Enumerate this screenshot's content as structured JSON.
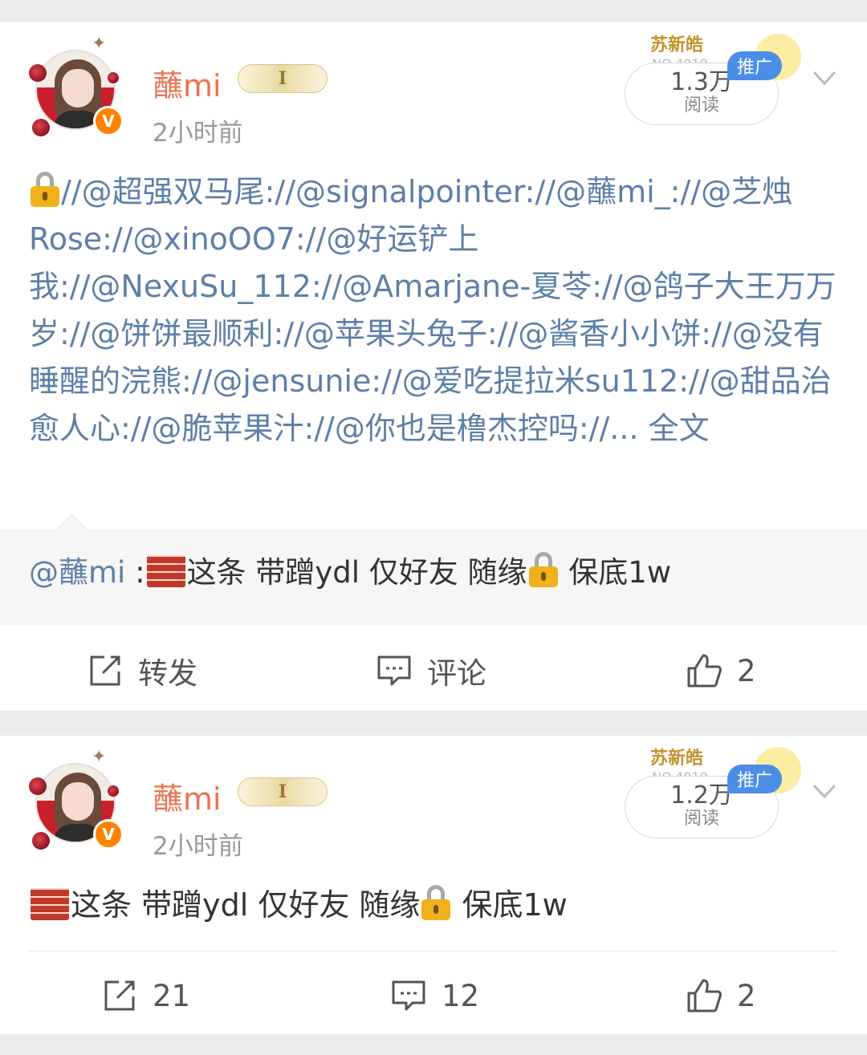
{
  "posts": [
    {
      "username": "蘸mi",
      "member_badge": "I",
      "timestamp": "2小时前",
      "ad_name": "苏新皓",
      "ad_no": "NO.4010",
      "promo_label": "推广",
      "reads_count": "1.3万",
      "reads_label": "阅读",
      "content_segments": [
        "//@超强双马尾",
        "://@signalpointer",
        "://@蘸mi_",
        "://@芝烛Rose",
        "://@xinoOO7",
        "://@好运铲上我",
        "://@NexuSu_112",
        "://@Amarjane-夏苓",
        "://@鸽子大王万万岁",
        "://@饼饼最顺利",
        "://@苹果头兔子",
        "://@酱香小小饼",
        "://@没有睡醒的浣熊",
        "://@jensunie",
        "://@爱吃提拉米su112",
        "://@甜品治愈人心",
        "://@脆苹果汁",
        "://@你也是橹杰控吗",
        "://... "
      ],
      "full_text_link": "全文",
      "repost": {
        "author": "@蘸mi",
        "sep": " :",
        "text_a": "这条 带蹭ydl 仅好友 随缘",
        "text_b": " 保底1w"
      },
      "actions": {
        "repost": "转发",
        "comment": "评论",
        "like": "2"
      }
    },
    {
      "username": "蘸mi",
      "member_badge": "I",
      "timestamp": "2小时前",
      "ad_name": "苏新皓",
      "ad_no": "NO.4010",
      "promo_label": "推广",
      "reads_count": "1.2万",
      "reads_label": "阅读",
      "text_a": "这条 带蹭ydl 仅好友 随缘",
      "text_b": " 保底1w",
      "actions": {
        "repost": "21",
        "comment": "12",
        "like": "2"
      }
    }
  ],
  "icons": {
    "verified": "verified-v-icon",
    "lock": "lock-icon",
    "brick": "brick-icon",
    "repost": "share-arrow-icon",
    "comment": "comment-bubble-icon",
    "like": "thumbs-up-icon",
    "chevron": "chevron-down-icon"
  },
  "colors": {
    "username": "#eb7350",
    "mention": "#5d7fa8",
    "promo": "#4a8ee8",
    "verified": "#ff8200"
  }
}
